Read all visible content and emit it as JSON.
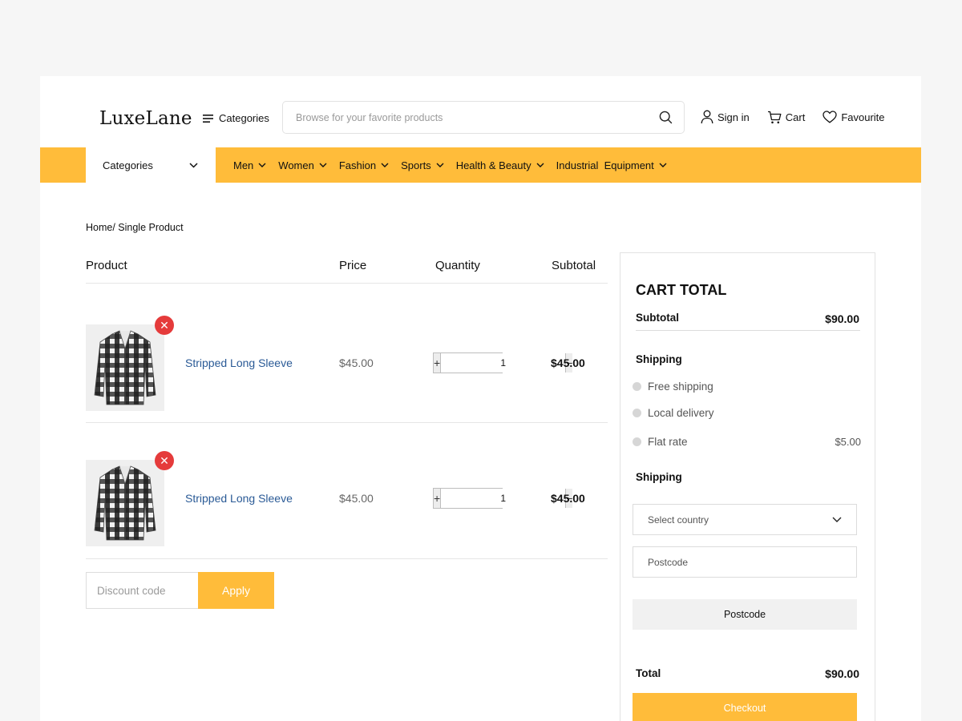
{
  "brand": {
    "logo": "LuxeLane"
  },
  "header": {
    "categories_label": "Categories",
    "search_placeholder": "Browse for your favorite products",
    "sign_in": "Sign in",
    "cart": "Cart",
    "favourite": "Favourite"
  },
  "nav": {
    "categories_dropdown": "Categories",
    "items": [
      {
        "label": "Men"
      },
      {
        "label": "Women"
      },
      {
        "label": "Fashion"
      },
      {
        "label": "Sports"
      },
      {
        "label": "Health & Beauty"
      },
      {
        "label": "Industrial  Equipment"
      }
    ]
  },
  "breadcrumb": "Home/ Single Product",
  "table": {
    "headers": {
      "product": "Product",
      "price": "Price",
      "quantity": "Quantity",
      "subtotal": "Subtotal"
    },
    "rows": [
      {
        "name": "Stripped Long Sleeve",
        "price": "$45.00",
        "qty": "1",
        "subtotal": "$45.00"
      },
      {
        "name": "Stripped Long Sleeve",
        "price": "$45.00",
        "qty": "1",
        "subtotal": "$45.00"
      }
    ]
  },
  "discount": {
    "placeholder": "Discount code",
    "apply": "Apply"
  },
  "cart_total": {
    "title": "CART TOTAL",
    "subtotal_label": "Subtotal",
    "subtotal_value": "$90.00",
    "shipping_label": "Shipping",
    "options": [
      {
        "label": "Free shipping",
        "price": ""
      },
      {
        "label": "Local delivery",
        "price": ""
      },
      {
        "label": "Flat rate",
        "price": "$5.00"
      }
    ],
    "shipping_label_2": "Shipping",
    "country_placeholder": "Select country",
    "postcode_placeholder": "Postcode",
    "postcode_button": "Postcode",
    "total_label": "Total",
    "total_value": "$90.00",
    "checkout": "Checkout"
  },
  "colors": {
    "accent": "#ffbc3a",
    "remove": "#e53b3b",
    "link": "#2a5a96"
  }
}
